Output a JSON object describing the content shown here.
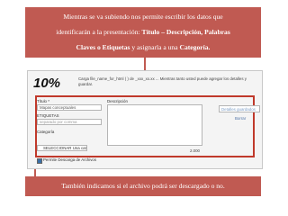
{
  "top_banner": {
    "line1": "Mientras se va subiendo  nos permite  escribir los datos  que",
    "line2_pre": "identificarán a la presentación: ",
    "line2_bold": "Título – Descripción, Palabras",
    "line3_bold1": "Claves o Etiquetas",
    "line3_mid": " y asignarla a una  ",
    "line3_bold2": "Categoría."
  },
  "upload_panel": {
    "progress_percent": "10%",
    "upload_info": "Carga  file_name_for_html  ( ) de _xxx_xx.xx ... Mientras tanto usted puede agregar los detalles y guardar.",
    "title_label": "Título *",
    "title_value": "Mapas conceptuales",
    "tags_label": "ETIQUETAS",
    "tags_placeholder": "separado por comma",
    "category_label": "Categoría",
    "category_selected": "SELECCIONAR Una categoría",
    "description_label": "Descripción",
    "char_counter": "2.000",
    "download_checkbox_label": "Permite Descarga de Archivos",
    "side_button": "Detalles guardados",
    "side_link": "Borrar"
  },
  "bottom_banner": {
    "text": "También indicamos si el archivo podrá ser descargado o no."
  },
  "colors": {
    "banner": "#c05a52",
    "highlight": "#c0392b"
  }
}
